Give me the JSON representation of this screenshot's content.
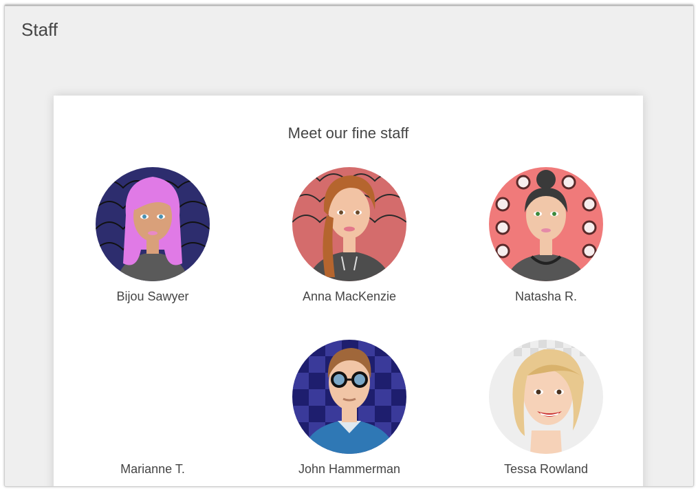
{
  "page": {
    "title": "Staff"
  },
  "card": {
    "heading": "Meet our fine staff"
  },
  "staff": [
    {
      "name": "Bijou Sawyer",
      "avatar_icon": "avatar-pink-hair-icon",
      "bg": "#2d2d6e",
      "hair": "#e07ae6",
      "skin": "#d9a07a",
      "top": "#5a5a5a"
    },
    {
      "name": "Anna MacKenzie",
      "avatar_icon": "avatar-auburn-braid-icon",
      "bg": "#d46c6c",
      "hair": "#b5652e",
      "skin": "#f2c3a4",
      "top": "#4d4d4d"
    },
    {
      "name": "Natasha R.",
      "avatar_icon": "avatar-bun-hair-icon",
      "bg": "#f07a7a",
      "hair": "#3a3a3a",
      "skin": "#f1c7a9",
      "top": "#555555"
    },
    {
      "name": "Marianne T.",
      "avatar_icon": "avatar-missing-icon"
    },
    {
      "name": "John Hammerman",
      "avatar_icon": "avatar-glasses-man-icon",
      "bg": "#1e1e6e",
      "hair": "#a0673a",
      "skin": "#f1c5a6",
      "top": "#2f78b5"
    },
    {
      "name": "Tessa Rowland",
      "avatar_icon": "avatar-blonde-smile-icon",
      "bg": "#eeeeee",
      "hair": "#e8c88e",
      "skin": "#f6d2b8",
      "top": "#ffffff"
    }
  ]
}
